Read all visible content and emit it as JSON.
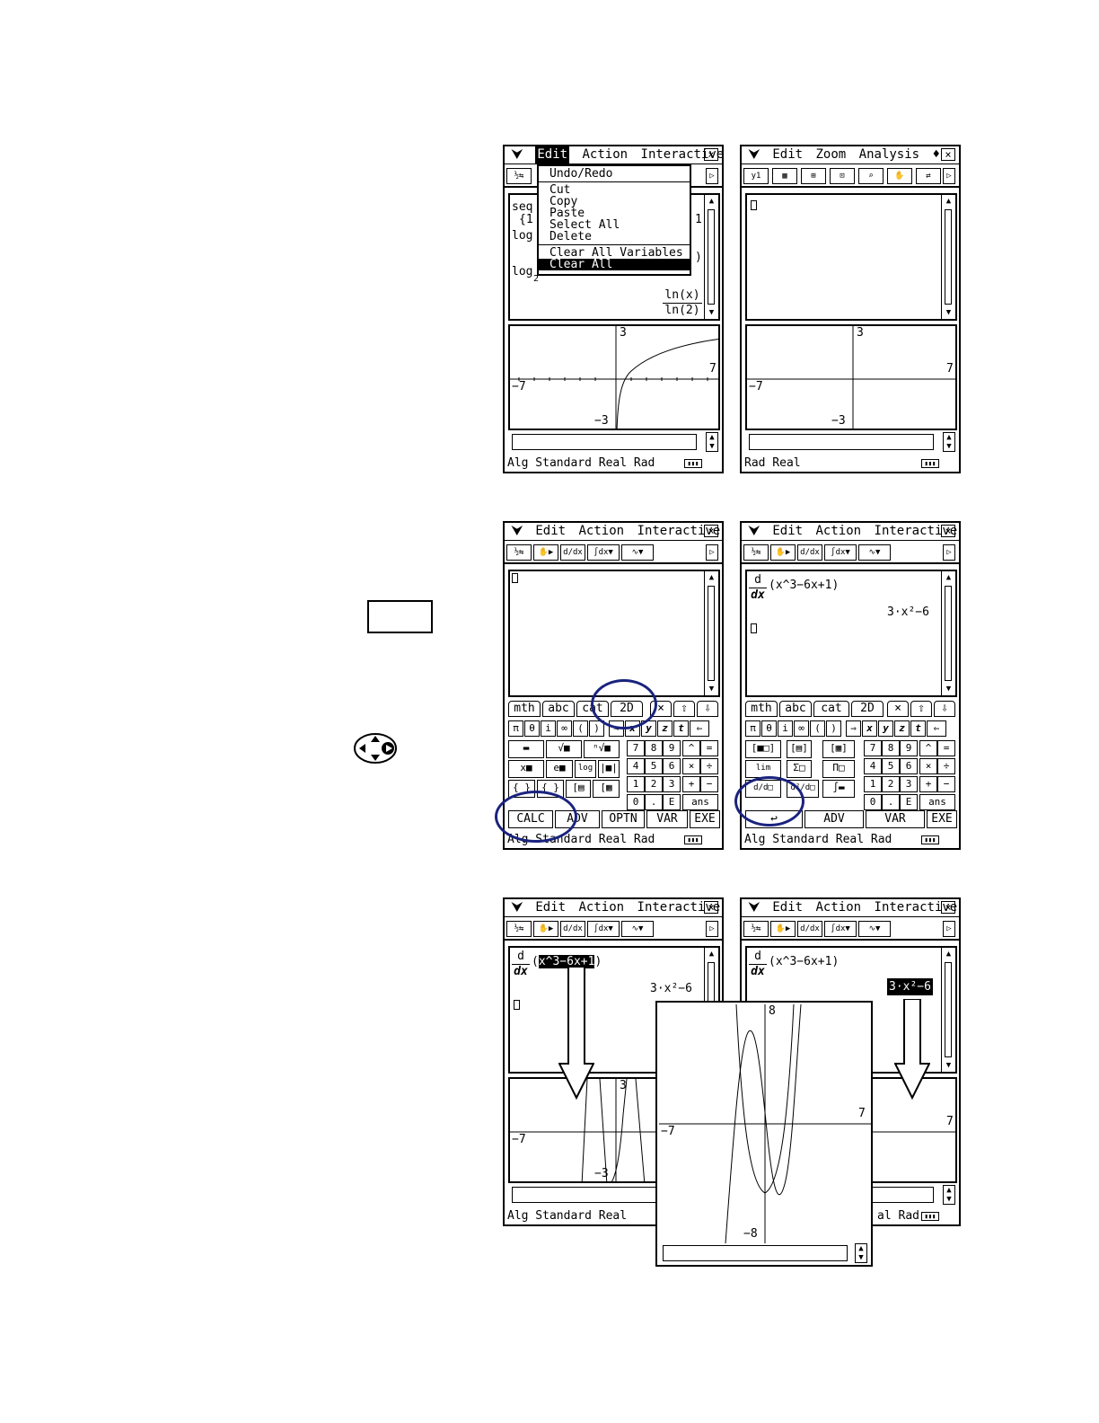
{
  "menus": {
    "main": [
      "Edit",
      "Action",
      "Interactive"
    ],
    "graph": [
      "Edit",
      "Zoom",
      "Analysis"
    ],
    "graph_marker": "♦"
  },
  "icons": {
    "chevron": "chevron-down-icon",
    "close": "close-icon",
    "scroll_up": "scroll-up-icon",
    "scroll_down": "scroll-down-icon",
    "battery": "battery-icon",
    "dpad": "dpad-icon",
    "arrow": "down-arrow-icon"
  },
  "edit_menu": {
    "items": [
      "Undo/Redo",
      "Cut",
      "Copy",
      "Paste",
      "Select All",
      "Delete",
      "Clear All Variables",
      "Clear All"
    ],
    "selected": "Clear All"
  },
  "status": {
    "main": "Alg    Standard Real Rad",
    "graph": "Rad  Real",
    "main_cut": "Alg    Standard Real",
    "right_cut": "al Rad"
  },
  "screen1": {
    "lines": [
      "seq",
      "{1",
      "log",
      "log",
      "2",
      "1",
      ")",
      "1"
    ],
    "frac_num": "ln(x)",
    "frac_den": "ln(2)"
  },
  "graph_axes": {
    "ymax": "3",
    "ymin": "−3",
    "xmin": "−7",
    "xmax": "7"
  },
  "big_graph_axes": {
    "ymax": "8",
    "ymin": "−8",
    "xmin": "−7",
    "xmax": "7"
  },
  "keyboard": {
    "tabs": [
      "mth",
      "abc",
      "cat",
      "2D"
    ],
    "vars": [
      "π",
      "θ",
      "i",
      "∞",
      "(",
      ")",
      "⇒",
      "x",
      "y",
      "z",
      "t",
      "⇐"
    ],
    "numpad": [
      "7",
      "8",
      "9",
      "^",
      "=",
      "4",
      "5",
      "6",
      "×",
      "÷",
      "1",
      "2",
      "3",
      "+",
      "−",
      "0",
      ".",
      "E",
      "ans"
    ],
    "soft_left": [
      "CALC",
      "ADV",
      "OPTN",
      "VAR",
      "EXE"
    ],
    "soft_right": [
      "↩",
      "ADV",
      "VAR",
      "EXE"
    ]
  },
  "derivative": {
    "d_num": "d",
    "d_den": "dx",
    "expr_open": "(",
    "expr_mid": "x^3−6x+1",
    "expr_close": ")",
    "result": "3·x²−6"
  }
}
